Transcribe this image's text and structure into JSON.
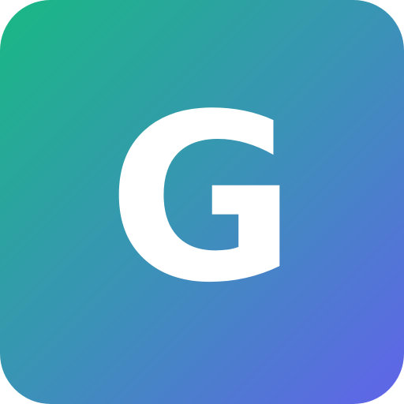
{
  "app_icon": {
    "letter": "G",
    "colors": {
      "gradient_start": "#19b884",
      "gradient_mid": "#3a93b6",
      "gradient_end": "#6163ea",
      "letter": "#ffffff"
    }
  }
}
